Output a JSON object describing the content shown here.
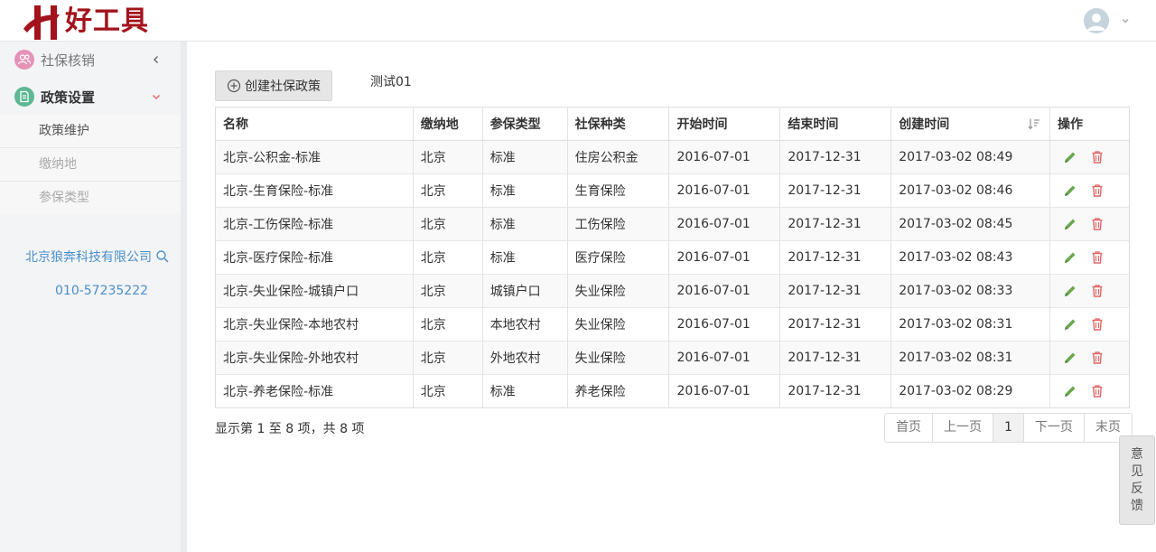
{
  "header": {
    "logo_text": "好工具"
  },
  "sidebar": {
    "items": [
      {
        "label": "社保核销",
        "icon": "users-icon"
      },
      {
        "label": "政策设置",
        "icon": "document-icon"
      }
    ],
    "subitems": [
      {
        "label": "政策维护"
      },
      {
        "label": "缴纳地"
      },
      {
        "label": "参保类型"
      }
    ],
    "company": "北京狼奔科技有限公司",
    "phone": "010-57235222"
  },
  "toolbar": {
    "create_label": "创建社保政策",
    "test_label": "测试01"
  },
  "table": {
    "headers": [
      "名称",
      "缴纳地",
      "参保类型",
      "社保种类",
      "开始时间",
      "结束时间",
      "创建时间",
      "操作"
    ],
    "rows": [
      [
        "北京-公积金-标准",
        "北京",
        "标准",
        "住房公积金",
        "2016-07-01",
        "2017-12-31",
        "2017-03-02 08:49"
      ],
      [
        "北京-生育保险-标准",
        "北京",
        "标准",
        "生育保险",
        "2016-07-01",
        "2017-12-31",
        "2017-03-02 08:46"
      ],
      [
        "北京-工伤保险-标准",
        "北京",
        "标准",
        "工伤保险",
        "2016-07-01",
        "2017-12-31",
        "2017-03-02 08:45"
      ],
      [
        "北京-医疗保险-标准",
        "北京",
        "标准",
        "医疗保险",
        "2016-07-01",
        "2017-12-31",
        "2017-03-02 08:43"
      ],
      [
        "北京-失业保险-城镇户口",
        "北京",
        "城镇户口",
        "失业保险",
        "2016-07-01",
        "2017-12-31",
        "2017-03-02 08:33"
      ],
      [
        "北京-失业保险-本地农村",
        "北京",
        "本地农村",
        "失业保险",
        "2016-07-01",
        "2017-12-31",
        "2017-03-02 08:31"
      ],
      [
        "北京-失业保险-外地农村",
        "北京",
        "外地农村",
        "失业保险",
        "2016-07-01",
        "2017-12-31",
        "2017-03-02 08:31"
      ],
      [
        "北京-养老保险-标准",
        "北京",
        "标准",
        "养老保险",
        "2016-07-01",
        "2017-12-31",
        "2017-03-02 08:29"
      ]
    ]
  },
  "footer": {
    "info": "显示第 1 至 8 项，共 8 项",
    "pager": {
      "first": "首页",
      "prev": "上一页",
      "current": "1",
      "next": "下一页",
      "last": "末页"
    }
  },
  "feedback": {
    "chars": [
      "意",
      "见",
      "反",
      "馈"
    ]
  },
  "colors": {
    "brand": "#a3131b",
    "link": "#4b8fc9",
    "edit": "#6aa84f",
    "delete": "#e06666"
  }
}
